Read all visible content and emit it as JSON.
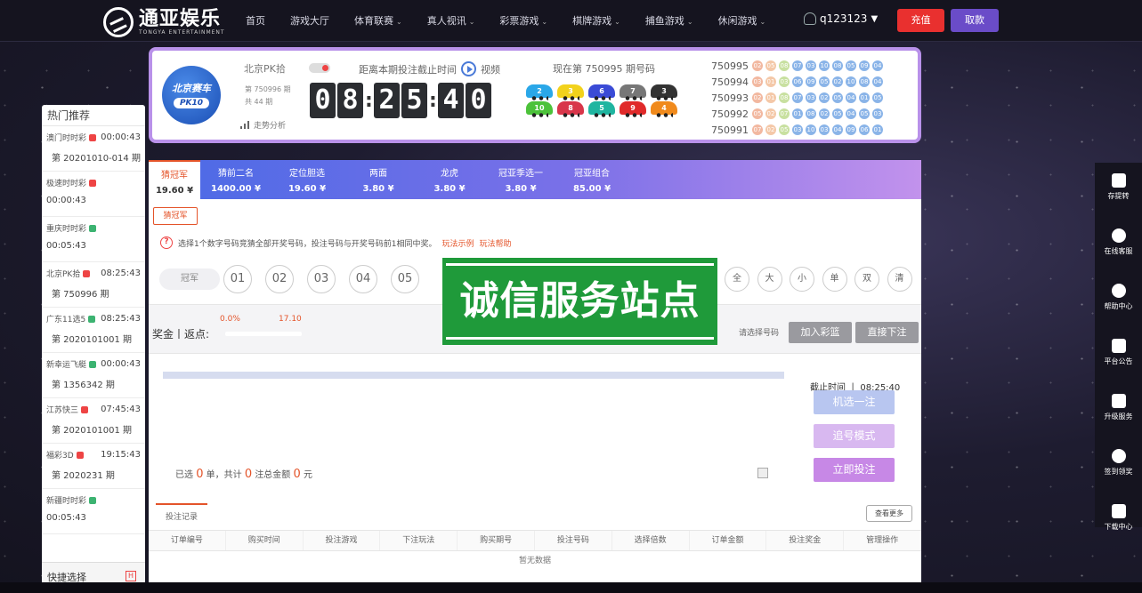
{
  "header": {
    "logo_text": "通亚娱乐",
    "logo_sub": "TONGYA ENTERTAINMENT",
    "nav": [
      {
        "label": "首页",
        "dropdown": false
      },
      {
        "label": "游戏大厅",
        "dropdown": false
      },
      {
        "label": "体育联赛",
        "dropdown": true
      },
      {
        "label": "真人视讯",
        "dropdown": true
      },
      {
        "label": "彩票游戏",
        "dropdown": true
      },
      {
        "label": "棋牌游戏",
        "dropdown": true
      },
      {
        "label": "捕鱼游戏",
        "dropdown": true
      },
      {
        "label": "休闲游戏",
        "dropdown": true
      }
    ],
    "username": "q123123",
    "recharge_label": "充值",
    "withdraw_label": "取款"
  },
  "game": {
    "logo_line1": "北京赛车",
    "logo_line2": "PK10",
    "name": "北京PK拾",
    "issue_line": "第 750996 期",
    "total_line": "共 44 期",
    "trend_label": "走势分析",
    "deadline_label": "距离本期投注截止时间",
    "video_label": "视频",
    "countdown": [
      "0",
      "8",
      "2",
      "5",
      "4",
      "0"
    ],
    "current_issue_label": "现在第 750995 期号码",
    "cars": [
      {
        "n": "2",
        "color": "#2aa7e8"
      },
      {
        "n": "3",
        "color": "#f2d21c"
      },
      {
        "n": "6",
        "color": "#3a4bd6"
      },
      {
        "n": "7",
        "color": "#777777"
      },
      {
        "n": "3",
        "color": "#333333"
      },
      {
        "n": "10",
        "color": "#4cc23a"
      },
      {
        "n": "8",
        "color": "#d8364a"
      },
      {
        "n": "5",
        "color": "#1fb5a0"
      },
      {
        "n": "9",
        "color": "#e02a2a"
      },
      {
        "n": "4",
        "color": "#f08a1c"
      }
    ],
    "results": [
      {
        "issue": "750995",
        "balls": [
          "02",
          "05",
          "08",
          "07",
          "03",
          "10",
          "08",
          "05",
          "09",
          "04"
        ]
      },
      {
        "issue": "750994",
        "balls": [
          "03",
          "01",
          "03",
          "06",
          "09",
          "05",
          "02",
          "10",
          "08",
          "04"
        ]
      },
      {
        "issue": "750993",
        "balls": [
          "02",
          "01",
          "08",
          "07",
          "03",
          "02",
          "05",
          "04",
          "01",
          "05"
        ]
      },
      {
        "issue": "750992",
        "balls": [
          "05",
          "02",
          "07",
          "01",
          "08",
          "02",
          "05",
          "04",
          "05",
          "03"
        ]
      },
      {
        "issue": "750991",
        "balls": [
          "07",
          "02",
          "05",
          "03",
          "10",
          "03",
          "04",
          "09",
          "06",
          "01"
        ]
      }
    ],
    "ball_colors": [
      "#f2b8a0",
      "#f4c8a8",
      "#c8e0a0",
      "#8ab4e8",
      "#8ab4e8",
      "#8ab4e8",
      "#8ab4e8",
      "#8ab4e8",
      "#8ab4e8",
      "#8ab4e8"
    ]
  },
  "hot": {
    "title": "热门推荐",
    "items": [
      {
        "name": "澳门时时彩",
        "badge": "#e44",
        "time": "00:00:43",
        "issue": "第 20201010-014 期"
      },
      {
        "name": "极速时时彩",
        "badge": "#e44",
        "time": "",
        "issue": "00:00:43"
      },
      {
        "name": "重庆时时彩",
        "badge": "#3cb371",
        "time": "",
        "issue": "00:05:43"
      },
      {
        "name": "北京PK拾",
        "badge": "#e44",
        "time": "08:25:43",
        "issue": "第 750996 期"
      },
      {
        "name": "广东11选5",
        "badge": "#3cb371",
        "time": "08:25:43",
        "issue": "第 2020101001 期"
      },
      {
        "name": "新幸运飞艇",
        "badge": "#3cb371",
        "time": "00:00:43",
        "issue": "第 1356342 期"
      },
      {
        "name": "江苏快三",
        "badge": "#e44",
        "time": "07:45:43",
        "issue": "第 2020101001 期"
      },
      {
        "name": "福彩3D",
        "badge": "#e44",
        "time": "19:15:43",
        "issue": "第 2020231 期"
      },
      {
        "name": "新疆时时彩",
        "badge": "#3cb371",
        "time": "",
        "issue": "00:05:43"
      }
    ],
    "quick_label": "快捷选择",
    "quick_badge": "H"
  },
  "tabs": [
    {
      "label": "猜冠军",
      "odds": "19.60 ¥",
      "active": true
    },
    {
      "label": "猜前二名",
      "odds": "1400.00 ¥",
      "active": false
    },
    {
      "label": "定位胆选",
      "odds": "19.60 ¥",
      "active": false
    },
    {
      "label": "两面",
      "odds": "3.80 ¥",
      "active": false
    },
    {
      "label": "龙虎",
      "odds": "3.80 ¥",
      "active": false
    },
    {
      "label": "冠亚季选一",
      "odds": "3.80 ¥",
      "active": false
    },
    {
      "label": "冠亚组合",
      "odds": "85.00 ¥",
      "active": false
    }
  ],
  "play": {
    "subtab": "猜冠军",
    "tip": "选择1个数字号码竞猜全部开奖号码，投注号码与开奖号码前1相同中奖。",
    "example_link": "玩法示例",
    "help_link": "玩法帮助",
    "pick_label": "冠军",
    "numbers": [
      "01",
      "02",
      "03",
      "04",
      "05"
    ],
    "quick_picks": [
      "全",
      "大",
      "小",
      "单",
      "双",
      "清"
    ]
  },
  "rebate": {
    "label": "奖金丨返点:",
    "percent": "0.0%",
    "value": "17.10",
    "select_hint": "请选择号码",
    "add_cart": "加入彩篮",
    "bet_direct": "直接下注"
  },
  "watermark": "诚信服务站点",
  "bet": {
    "summary_prefix": "已选",
    "count": "0",
    "summary_mid1": "单，共计",
    "notes": "0",
    "summary_mid2": "注总金额",
    "amount": "0",
    "summary_suffix": "元",
    "deadline": "截止时间 丨 08:25:40",
    "random_btn": "机选一注",
    "chase_btn": "追号模式",
    "submit_btn": "立即投注"
  },
  "records": {
    "tab": "投注记录",
    "more": "查看更多",
    "columns": [
      "订单编号",
      "购买时间",
      "投注游戏",
      "下注玩法",
      "购买期号",
      "投注号码",
      "选择倍数",
      "订单金额",
      "投注奖金",
      "管理操作"
    ],
    "empty": "暂无数据"
  },
  "side_tools": [
    {
      "label": "存提转",
      "icon": "wallet-icon"
    },
    {
      "label": "在线客服",
      "icon": "headset-icon"
    },
    {
      "label": "帮助中心",
      "icon": "help-icon"
    },
    {
      "label": "平台公告",
      "icon": "speaker-icon"
    },
    {
      "label": "升级服务",
      "icon": "heartbeat-icon"
    },
    {
      "label": "签到领奖",
      "icon": "check-icon"
    },
    {
      "label": "下载中心",
      "icon": "phone-icon"
    }
  ]
}
